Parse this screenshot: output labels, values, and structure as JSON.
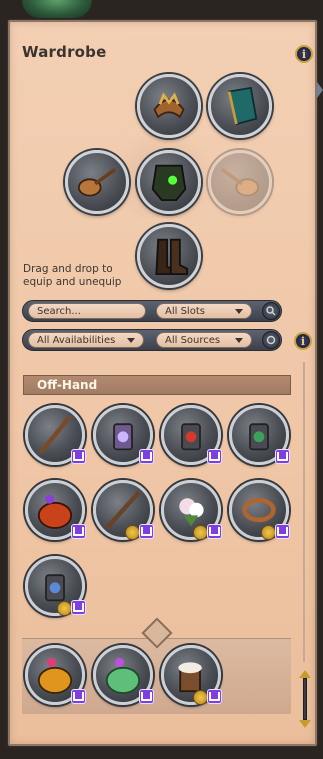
{
  "wardrobe": {
    "title": "Wardrobe",
    "info_icon": "i",
    "drag_hint": "Drag and drop to equip and unequip"
  },
  "slots": [
    {
      "name": "head",
      "icon": "crown-headpiece-icon"
    },
    {
      "name": "back",
      "icon": "teal-cape-icon"
    },
    {
      "name": "main-hand",
      "icon": "lute-icon"
    },
    {
      "name": "chest",
      "icon": "green-armor-icon"
    },
    {
      "name": "off-hand",
      "icon": "lute-icon",
      "empty": true
    },
    {
      "name": "feet",
      "icon": "boots-icon"
    }
  ],
  "filters": {
    "search_placeholder": "Search...",
    "slots_select": "All Slots",
    "availability_select": "All Availabilities",
    "sources_select": "All Sources"
  },
  "category": {
    "label": "Off-Hand"
  },
  "items": [
    {
      "icon": "staff-icon",
      "badges": [
        "twitch"
      ]
    },
    {
      "icon": "purple-lantern-icon",
      "badges": [
        "twitch"
      ]
    },
    {
      "icon": "red-lantern-icon",
      "badges": [
        "twitch"
      ]
    },
    {
      "icon": "green-lantern-icon",
      "badges": [
        "twitch"
      ]
    },
    {
      "icon": "pumpkin-candy-bag-icon",
      "badges": [
        "twitch"
      ]
    },
    {
      "icon": "twisted-staff-icon",
      "badges": [
        "coin",
        "twitch"
      ]
    },
    {
      "icon": "flower-bouquet-icon",
      "badges": [
        "coin",
        "twitch"
      ]
    },
    {
      "icon": "bronze-ring-icon",
      "badges": [
        "coin",
        "twitch"
      ]
    },
    {
      "icon": "blue-lantern-icon",
      "badges": [
        "coin",
        "twitch"
      ]
    },
    {
      "icon": "orange-candy-bag-icon",
      "badges": [
        "twitch"
      ]
    },
    {
      "icon": "green-candy-bag-icon",
      "badges": [
        "twitch"
      ]
    },
    {
      "icon": "frothy-mug-icon",
      "badges": [
        "coin",
        "twitch"
      ]
    }
  ],
  "colors": {
    "panel": "#efc6a6",
    "accent_gold": "#c8a236",
    "twitch_purple": "#7f3fe0"
  }
}
